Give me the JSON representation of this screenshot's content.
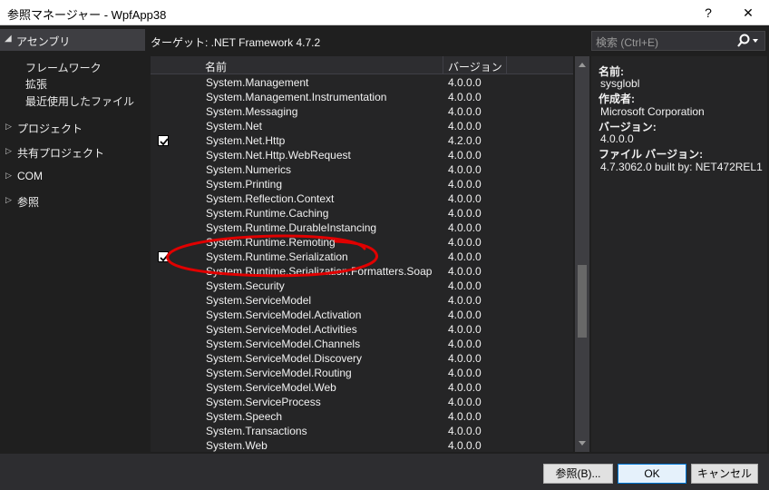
{
  "window": {
    "title": "参照マネージャー - WpfApp38",
    "help": "?",
    "close": "✕"
  },
  "sidebar": {
    "assemblies": "アセンブリ",
    "sub_items": [
      "フレームワーク",
      "拡張",
      "最近使用したファイル"
    ],
    "items": [
      "プロジェクト",
      "共有プロジェクト",
      "COM",
      "参照"
    ]
  },
  "target": "ターゲット: .NET Framework 4.7.2",
  "search": {
    "placeholder": "検索 (Ctrl+E)"
  },
  "list": {
    "col_name": "名前",
    "col_version": "バージョン",
    "rows": [
      {
        "name": "System.Management",
        "version": "4.0.0.0",
        "checked": false
      },
      {
        "name": "System.Management.Instrumentation",
        "version": "4.0.0.0",
        "checked": false
      },
      {
        "name": "System.Messaging",
        "version": "4.0.0.0",
        "checked": false
      },
      {
        "name": "System.Net",
        "version": "4.0.0.0",
        "checked": false
      },
      {
        "name": "System.Net.Http",
        "version": "4.2.0.0",
        "checked": true
      },
      {
        "name": "System.Net.Http.WebRequest",
        "version": "4.0.0.0",
        "checked": false
      },
      {
        "name": "System.Numerics",
        "version": "4.0.0.0",
        "checked": false
      },
      {
        "name": "System.Printing",
        "version": "4.0.0.0",
        "checked": false
      },
      {
        "name": "System.Reflection.Context",
        "version": "4.0.0.0",
        "checked": false
      },
      {
        "name": "System.Runtime.Caching",
        "version": "4.0.0.0",
        "checked": false
      },
      {
        "name": "System.Runtime.DurableInstancing",
        "version": "4.0.0.0",
        "checked": false
      },
      {
        "name": "System.Runtime.Remoting",
        "version": "4.0.0.0",
        "checked": false
      },
      {
        "name": "System.Runtime.Serialization",
        "version": "4.0.0.0",
        "checked": true
      },
      {
        "name": "System.Runtime.Serialization.Formatters.Soap",
        "version": "4.0.0.0",
        "checked": false
      },
      {
        "name": "System.Security",
        "version": "4.0.0.0",
        "checked": false
      },
      {
        "name": "System.ServiceModel",
        "version": "4.0.0.0",
        "checked": false
      },
      {
        "name": "System.ServiceModel.Activation",
        "version": "4.0.0.0",
        "checked": false
      },
      {
        "name": "System.ServiceModel.Activities",
        "version": "4.0.0.0",
        "checked": false
      },
      {
        "name": "System.ServiceModel.Channels",
        "version": "4.0.0.0",
        "checked": false
      },
      {
        "name": "System.ServiceModel.Discovery",
        "version": "4.0.0.0",
        "checked": false
      },
      {
        "name": "System.ServiceModel.Routing",
        "version": "4.0.0.0",
        "checked": false
      },
      {
        "name": "System.ServiceModel.Web",
        "version": "4.0.0.0",
        "checked": false
      },
      {
        "name": "System.ServiceProcess",
        "version": "4.0.0.0",
        "checked": false
      },
      {
        "name": "System.Speech",
        "version": "4.0.0.0",
        "checked": false
      },
      {
        "name": "System.Transactions",
        "version": "4.0.0.0",
        "checked": false
      },
      {
        "name": "System.Web",
        "version": "4.0.0.0",
        "checked": false
      }
    ]
  },
  "details": {
    "name_label": "名前:",
    "name_value": "sysglobl",
    "author_label": "作成者:",
    "author_value": "Microsoft Corporation",
    "version_label": "バージョン:",
    "version_value": "4.0.0.0",
    "file_version_label": "ファイル バージョン:",
    "file_version_value": "4.7.3062.0 built by: NET472REL1"
  },
  "buttons": {
    "browse": "参照(B)...",
    "ok": "OK",
    "cancel": "キャンセル"
  },
  "colors": {
    "background": "#1f1f1f",
    "panel": "#252526",
    "annotation": "#e00000"
  }
}
